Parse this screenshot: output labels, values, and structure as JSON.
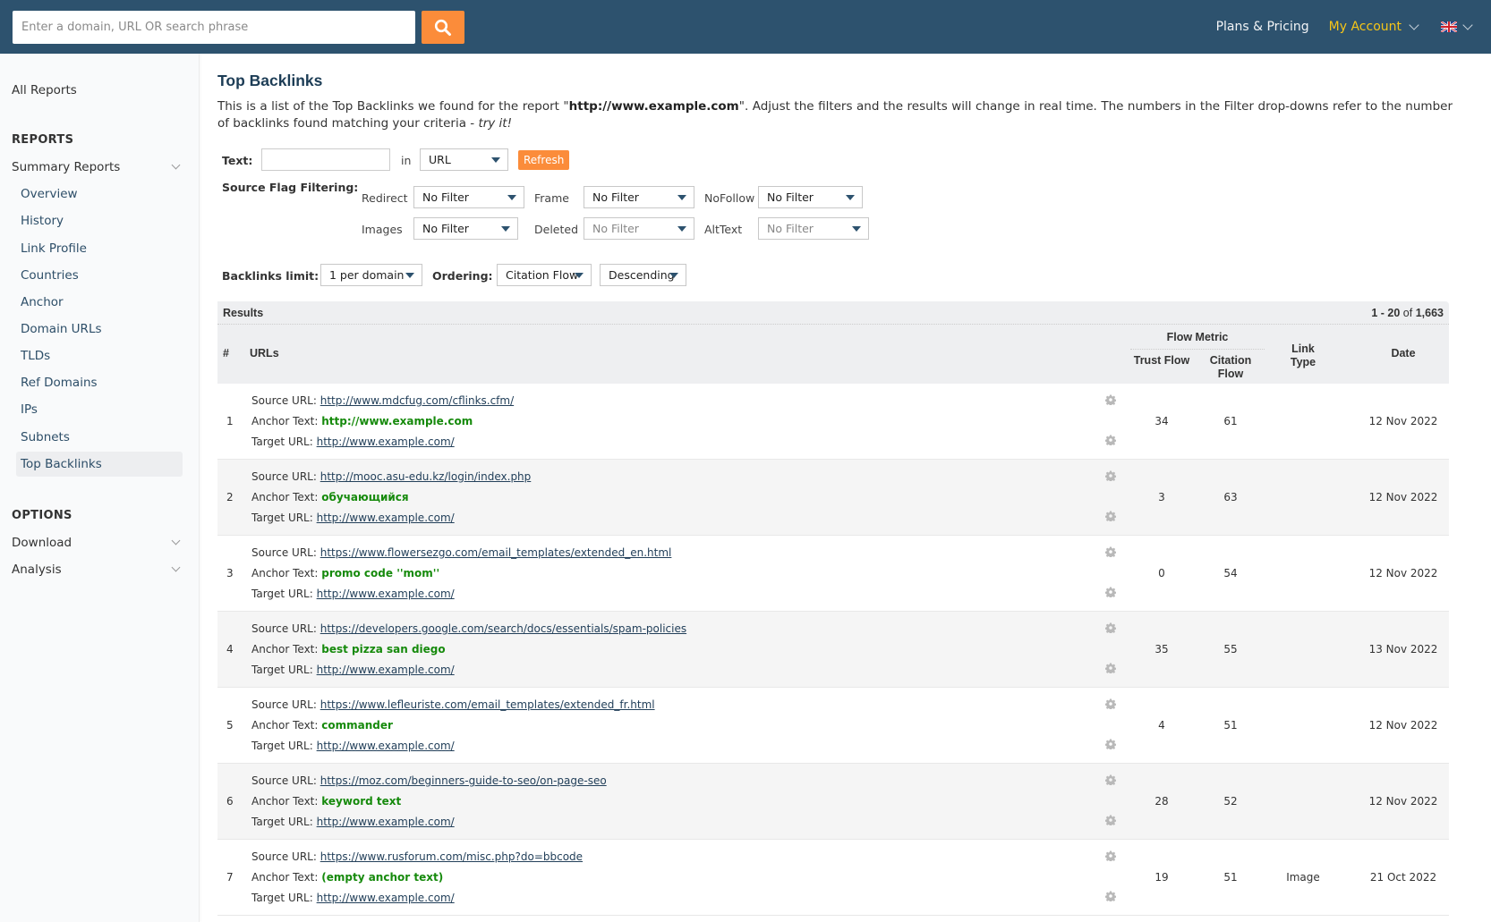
{
  "header": {
    "search_placeholder": "Enter a domain, URL OR search phrase",
    "search_icon": "search-icon",
    "nav": {
      "plans_label": "Plans & Pricing",
      "account_label": "My Account",
      "language_icon": "uk-flag-icon"
    },
    "colors": {
      "bar": "#2d526e",
      "accent": "#fb8c3a",
      "account": "#f5c518"
    }
  },
  "sidebar": {
    "all_reports": "All Reports",
    "reports_heading": "REPORTS",
    "summary_reports": "Summary Reports",
    "items": [
      {
        "label": "Overview"
      },
      {
        "label": "History"
      },
      {
        "label": "Link Profile"
      },
      {
        "label": "Countries"
      },
      {
        "label": "Anchor"
      },
      {
        "label": "Domain URLs"
      },
      {
        "label": "TLDs"
      },
      {
        "label": "Ref Domains"
      },
      {
        "label": "IPs"
      },
      {
        "label": "Subnets"
      },
      {
        "label": "Top Backlinks",
        "active": true
      }
    ],
    "options_heading": "OPTIONS",
    "download": "Download",
    "analysis": "Analysis"
  },
  "main": {
    "title": "Top Backlinks",
    "intro_pre": "This is a list of the Top Backlinks we found for the report \"",
    "intro_domain": "http://www.example.com",
    "intro_post": "\". Adjust the filters and the results will change in real time. The numbers in the Filter drop-downs refer to the number of backlinks found matching your criteria - ",
    "intro_try": "try it!",
    "filters": {
      "text_label": "Text:",
      "text_value": "",
      "in_label": "in",
      "in_value": "URL",
      "refresh_label": "Refresh",
      "source_flag_label": "Source Flag Filtering:",
      "redirect_label": "Redirect",
      "redirect_value": "No Filter",
      "frame_label": "Frame",
      "frame_value": "No Filter",
      "nofollow_label": "NoFollow",
      "nofollow_value": "No Filter",
      "images_label": "Images",
      "images_value": "No Filter",
      "deleted_label": "Deleted",
      "deleted_value": "No Filter",
      "alttext_label": "AltText",
      "alttext_value": "No Filter",
      "limit_label": "Backlinks limit:",
      "limit_value": "1 per domain",
      "ordering_label": "Ordering:",
      "ordering_value": "Citation Flow",
      "direction_value": "Descending"
    },
    "results": {
      "title": "Results",
      "range_start": "1",
      "range_end": "20",
      "of_label": "of",
      "total": "1,663",
      "columns": {
        "num": "#",
        "urls": "URLs",
        "flow_metric": "Flow Metric",
        "trust_flow": "Trust Flow",
        "citation_flow": "Citation Flow",
        "link_type": "Link Type",
        "date": "Date"
      },
      "labels": {
        "source": "Source URL:",
        "anchor": "Anchor Text:",
        "target": "Target URL:"
      },
      "rows": [
        {
          "num": "1",
          "source": "http://www.mdcfug.com/cflinks.cfm/",
          "anchor": "http://www.example.com",
          "target": "http://www.example.com/",
          "trust": "34",
          "citation": "61",
          "link_type": "",
          "date": "12 Nov 2022"
        },
        {
          "num": "2",
          "source": "http://mooc.asu-edu.kz/login/index.php",
          "anchor": "обучающийся",
          "target": "http://www.example.com/",
          "trust": "3",
          "citation": "63",
          "link_type": "",
          "date": "12 Nov 2022"
        },
        {
          "num": "3",
          "source": "https://www.flowersezgo.com/email_templates/extended_en.html",
          "anchor": "promo code ''mom''",
          "target": "http://www.example.com/",
          "trust": "0",
          "citation": "54",
          "link_type": "",
          "date": "12 Nov 2022"
        },
        {
          "num": "4",
          "source": "https://developers.google.com/search/docs/essentials/spam-policies",
          "anchor": "best pizza san diego",
          "target": "http://www.example.com/",
          "trust": "35",
          "citation": "55",
          "link_type": "",
          "date": "13 Nov 2022"
        },
        {
          "num": "5",
          "source": "https://www.lefleuriste.com/email_templates/extended_fr.html",
          "anchor": "commander",
          "target": "http://www.example.com/",
          "trust": "4",
          "citation": "51",
          "link_type": "",
          "date": "12 Nov 2022"
        },
        {
          "num": "6",
          "source": "https://moz.com/beginners-guide-to-seo/on-page-seo",
          "anchor": "keyword text",
          "target": "http://www.example.com/",
          "trust": "28",
          "citation": "52",
          "link_type": "",
          "date": "12 Nov 2022"
        },
        {
          "num": "7",
          "source": "https://www.rusforum.com/misc.php?do=bbcode",
          "anchor": "(empty anchor text)",
          "target": "http://www.example.com/",
          "trust": "19",
          "citation": "51",
          "link_type": "Image",
          "date": "21 Oct 2022"
        }
      ]
    }
  }
}
